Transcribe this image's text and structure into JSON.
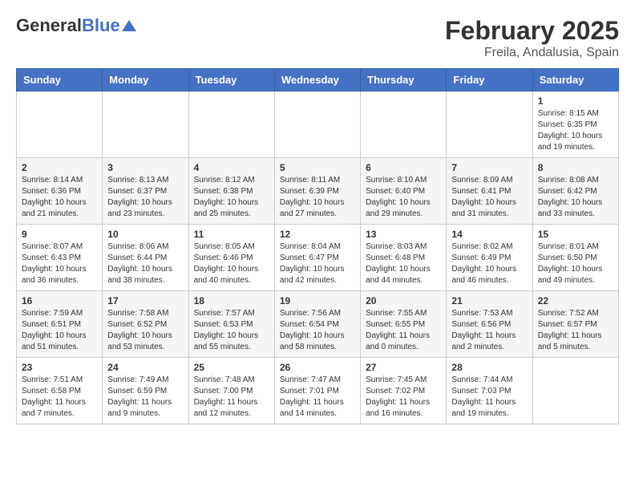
{
  "header": {
    "logo_general": "General",
    "logo_blue": "Blue",
    "title": "February 2025",
    "subtitle": "Freila, Andalusia, Spain"
  },
  "days_of_week": [
    "Sunday",
    "Monday",
    "Tuesday",
    "Wednesday",
    "Thursday",
    "Friday",
    "Saturday"
  ],
  "weeks": [
    [
      {
        "day": "",
        "info": ""
      },
      {
        "day": "",
        "info": ""
      },
      {
        "day": "",
        "info": ""
      },
      {
        "day": "",
        "info": ""
      },
      {
        "day": "",
        "info": ""
      },
      {
        "day": "",
        "info": ""
      },
      {
        "day": "1",
        "info": "Sunrise: 8:15 AM\nSunset: 6:35 PM\nDaylight: 10 hours and 19 minutes."
      }
    ],
    [
      {
        "day": "2",
        "info": "Sunrise: 8:14 AM\nSunset: 6:36 PM\nDaylight: 10 hours and 21 minutes."
      },
      {
        "day": "3",
        "info": "Sunrise: 8:13 AM\nSunset: 6:37 PM\nDaylight: 10 hours and 23 minutes."
      },
      {
        "day": "4",
        "info": "Sunrise: 8:12 AM\nSunset: 6:38 PM\nDaylight: 10 hours and 25 minutes."
      },
      {
        "day": "5",
        "info": "Sunrise: 8:11 AM\nSunset: 6:39 PM\nDaylight: 10 hours and 27 minutes."
      },
      {
        "day": "6",
        "info": "Sunrise: 8:10 AM\nSunset: 6:40 PM\nDaylight: 10 hours and 29 minutes."
      },
      {
        "day": "7",
        "info": "Sunrise: 8:09 AM\nSunset: 6:41 PM\nDaylight: 10 hours and 31 minutes."
      },
      {
        "day": "8",
        "info": "Sunrise: 8:08 AM\nSunset: 6:42 PM\nDaylight: 10 hours and 33 minutes."
      }
    ],
    [
      {
        "day": "9",
        "info": "Sunrise: 8:07 AM\nSunset: 6:43 PM\nDaylight: 10 hours and 36 minutes."
      },
      {
        "day": "10",
        "info": "Sunrise: 8:06 AM\nSunset: 6:44 PM\nDaylight: 10 hours and 38 minutes."
      },
      {
        "day": "11",
        "info": "Sunrise: 8:05 AM\nSunset: 6:46 PM\nDaylight: 10 hours and 40 minutes."
      },
      {
        "day": "12",
        "info": "Sunrise: 8:04 AM\nSunset: 6:47 PM\nDaylight: 10 hours and 42 minutes."
      },
      {
        "day": "13",
        "info": "Sunrise: 8:03 AM\nSunset: 6:48 PM\nDaylight: 10 hours and 44 minutes."
      },
      {
        "day": "14",
        "info": "Sunrise: 8:02 AM\nSunset: 6:49 PM\nDaylight: 10 hours and 46 minutes."
      },
      {
        "day": "15",
        "info": "Sunrise: 8:01 AM\nSunset: 6:50 PM\nDaylight: 10 hours and 49 minutes."
      }
    ],
    [
      {
        "day": "16",
        "info": "Sunrise: 7:59 AM\nSunset: 6:51 PM\nDaylight: 10 hours and 51 minutes."
      },
      {
        "day": "17",
        "info": "Sunrise: 7:58 AM\nSunset: 6:52 PM\nDaylight: 10 hours and 53 minutes."
      },
      {
        "day": "18",
        "info": "Sunrise: 7:57 AM\nSunset: 6:53 PM\nDaylight: 10 hours and 55 minutes."
      },
      {
        "day": "19",
        "info": "Sunrise: 7:56 AM\nSunset: 6:54 PM\nDaylight: 10 hours and 58 minutes."
      },
      {
        "day": "20",
        "info": "Sunrise: 7:55 AM\nSunset: 6:55 PM\nDaylight: 11 hours and 0 minutes."
      },
      {
        "day": "21",
        "info": "Sunrise: 7:53 AM\nSunset: 6:56 PM\nDaylight: 11 hours and 2 minutes."
      },
      {
        "day": "22",
        "info": "Sunrise: 7:52 AM\nSunset: 6:57 PM\nDaylight: 11 hours and 5 minutes."
      }
    ],
    [
      {
        "day": "23",
        "info": "Sunrise: 7:51 AM\nSunset: 6:58 PM\nDaylight: 11 hours and 7 minutes."
      },
      {
        "day": "24",
        "info": "Sunrise: 7:49 AM\nSunset: 6:59 PM\nDaylight: 11 hours and 9 minutes."
      },
      {
        "day": "25",
        "info": "Sunrise: 7:48 AM\nSunset: 7:00 PM\nDaylight: 11 hours and 12 minutes."
      },
      {
        "day": "26",
        "info": "Sunrise: 7:47 AM\nSunset: 7:01 PM\nDaylight: 11 hours and 14 minutes."
      },
      {
        "day": "27",
        "info": "Sunrise: 7:45 AM\nSunset: 7:02 PM\nDaylight: 11 hours and 16 minutes."
      },
      {
        "day": "28",
        "info": "Sunrise: 7:44 AM\nSunset: 7:03 PM\nDaylight: 11 hours and 19 minutes."
      },
      {
        "day": "",
        "info": ""
      }
    ]
  ]
}
